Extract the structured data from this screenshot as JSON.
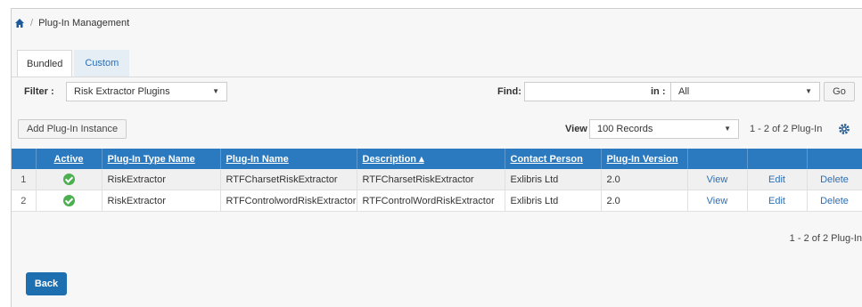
{
  "breadcrumb": {
    "current": "Plug-In Management",
    "separator": "/"
  },
  "tabs": [
    {
      "label": "Bundled",
      "active": true
    },
    {
      "label": "Custom",
      "active": false
    }
  ],
  "filter": {
    "label": "Filter :",
    "value": "Risk Extractor Plugins",
    "find_label": "Find:",
    "find_value": "",
    "in_label": "in :",
    "in_value": "All",
    "go_label": "Go"
  },
  "toolbar": {
    "add_label": "Add Plug-In Instance",
    "view_label": "View",
    "view_value": "100 Records",
    "pager_text": "1 - 2 of 2 Plug-In"
  },
  "table": {
    "headers": [
      "",
      "Active",
      "Plug-In Type Name",
      "Plug-In Name",
      "Description ▴",
      "Contact Person",
      "Plug-In Version",
      "",
      "",
      ""
    ],
    "rows": [
      {
        "num": "1",
        "type": "RiskExtractor",
        "name": "RTFCharsetRiskExtractor",
        "desc": "RTFCharsetRiskExtractor",
        "contact": "Exlibris Ltd",
        "version": "2.0",
        "view": "View",
        "edit": "Edit",
        "delete": "Delete"
      },
      {
        "num": "2",
        "type": "RiskExtractor",
        "name": "RTFControlwordRiskExtractor",
        "desc": "RTFControlWordRiskExtractor",
        "contact": "Exlibris Ltd",
        "version": "2.0",
        "view": "View",
        "edit": "Edit",
        "delete": "Delete"
      }
    ]
  },
  "pager_bottom": "1 - 2 of 2 Plug-In",
  "back_label": "Back",
  "colors": {
    "header_bg": "#2b7ac0",
    "link": "#2b6fb6",
    "back_bg": "#1e6fb0",
    "active_check": "#4caf50"
  }
}
